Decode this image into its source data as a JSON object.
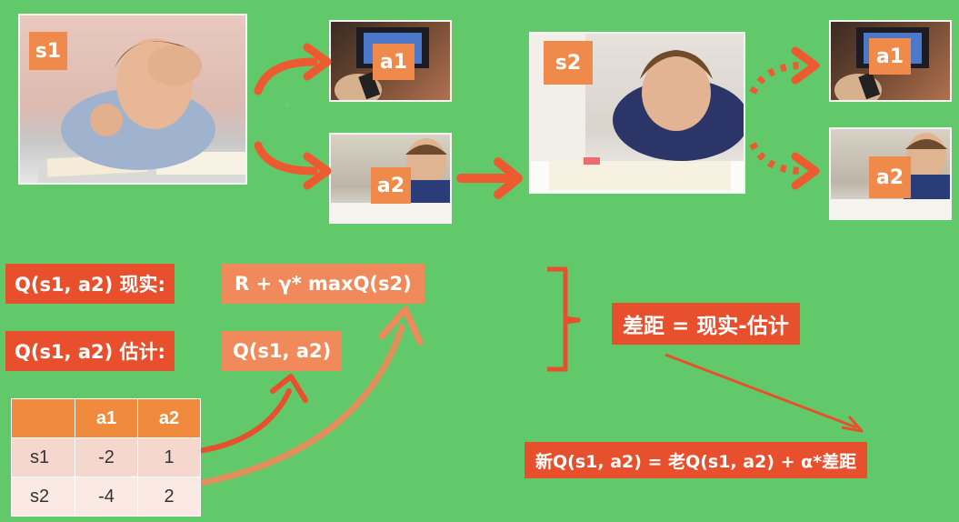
{
  "scene": {
    "s1_label": "s1",
    "a1_label": "a1",
    "a2_label": "a2",
    "s2_label": "s2",
    "next_a1_label": "a1",
    "next_a2_label": "a2"
  },
  "formulas": {
    "reality_label": "Q(s1, a2) 现实:",
    "reality_value": "R + γ* maxQ(s2)",
    "estimate_label": "Q(s1, a2) 估计:",
    "estimate_value": "Q(s1, a2)",
    "gap": "差距 = 现实-估计",
    "update": "新Q(s1, a2) = 老Q(s1, a2) + α*差距"
  },
  "q_table": {
    "columns": [
      "",
      "a1",
      "a2"
    ],
    "rows": [
      {
        "state": "s1",
        "a1": "-2",
        "a2": "1"
      },
      {
        "state": "s2",
        "a1": "-4",
        "a2": "2"
      }
    ]
  },
  "colors": {
    "background": "#62c96a",
    "accent_dark": "#e8502d",
    "accent_light": "#f08a5a",
    "arrow": "#ee5a2f"
  }
}
